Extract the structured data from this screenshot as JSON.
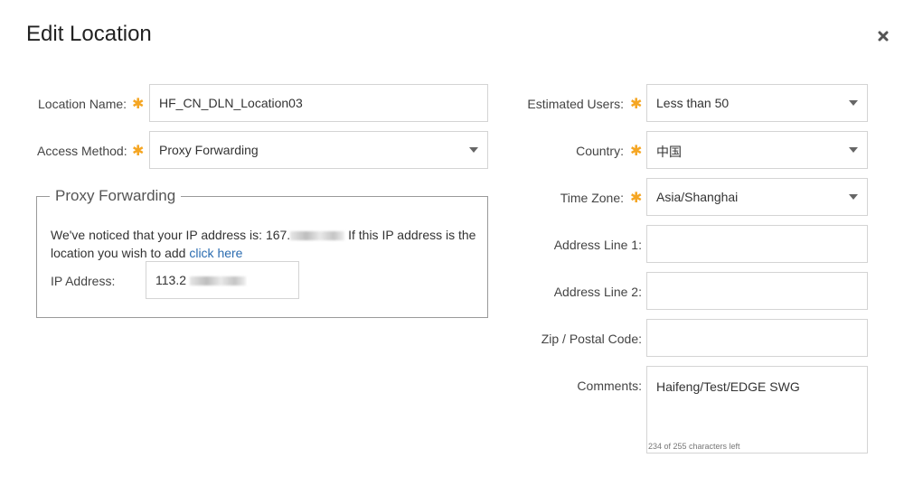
{
  "dialog": {
    "title": "Edit Location",
    "close_icon": "close-x-icon"
  },
  "left": {
    "location_name": {
      "label": "Location Name:",
      "value": "HF_CN_DLN_Location03"
    },
    "access_method": {
      "label": "Access Method:",
      "value": "Proxy Forwarding"
    },
    "proxy_forwarding": {
      "legend": "Proxy Forwarding",
      "notice_prefix": "We've noticed that your IP address is: 167.",
      "notice_suffix": " If this IP address is the location you wish to add ",
      "click_here": "click here",
      "ip_label": "IP Address:",
      "ip_value": "113.2"
    }
  },
  "right": {
    "estimated_users": {
      "label": "Estimated Users:",
      "value": "Less than 50"
    },
    "country": {
      "label": "Country:",
      "value": "中国"
    },
    "time_zone": {
      "label": "Time Zone:",
      "value": "Asia/Shanghai"
    },
    "address_line_1": {
      "label": "Address Line 1:",
      "value": ""
    },
    "address_line_2": {
      "label": "Address Line 2:",
      "value": ""
    },
    "zip": {
      "label": "Zip / Postal Code:",
      "value": ""
    },
    "comments": {
      "label": "Comments:",
      "value": "Haifeng/Test/EDGE SWG",
      "count": "234 of 255 characters left"
    }
  },
  "required_marker": "✱",
  "colors": {
    "required": "#f5a623",
    "link": "#2b6cb0",
    "border": "#d4d4d4"
  }
}
